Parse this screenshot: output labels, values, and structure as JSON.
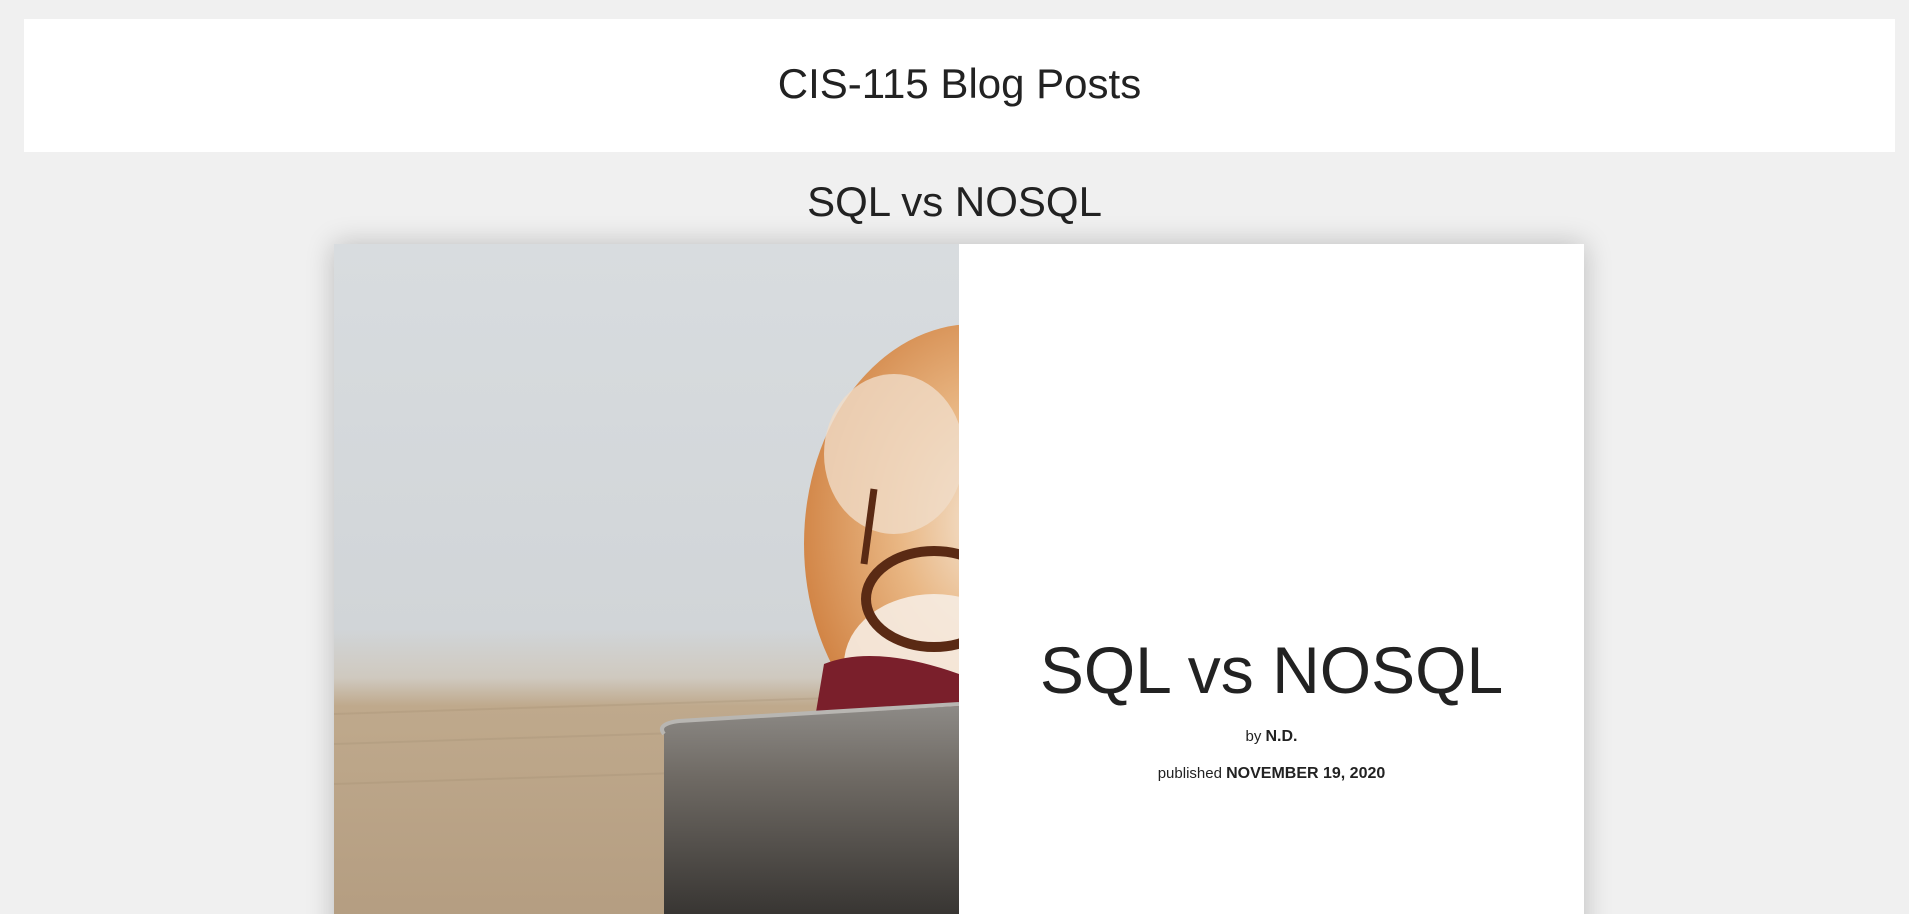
{
  "site": {
    "title": "CIS-115 Blog Posts"
  },
  "post": {
    "heading": "SQL vs NOSQL",
    "title": "SQL vs NOSQL",
    "author_prefix": "by",
    "author": "N.D.",
    "date_prefix": "published",
    "date": "NOVEMBER 19, 2020",
    "image_alt": "Pomeranian dog wearing glasses looking at a laptop"
  },
  "colors": {
    "page_background": "#f0f0f0",
    "card_background": "#ffffff",
    "text": "#222222"
  }
}
